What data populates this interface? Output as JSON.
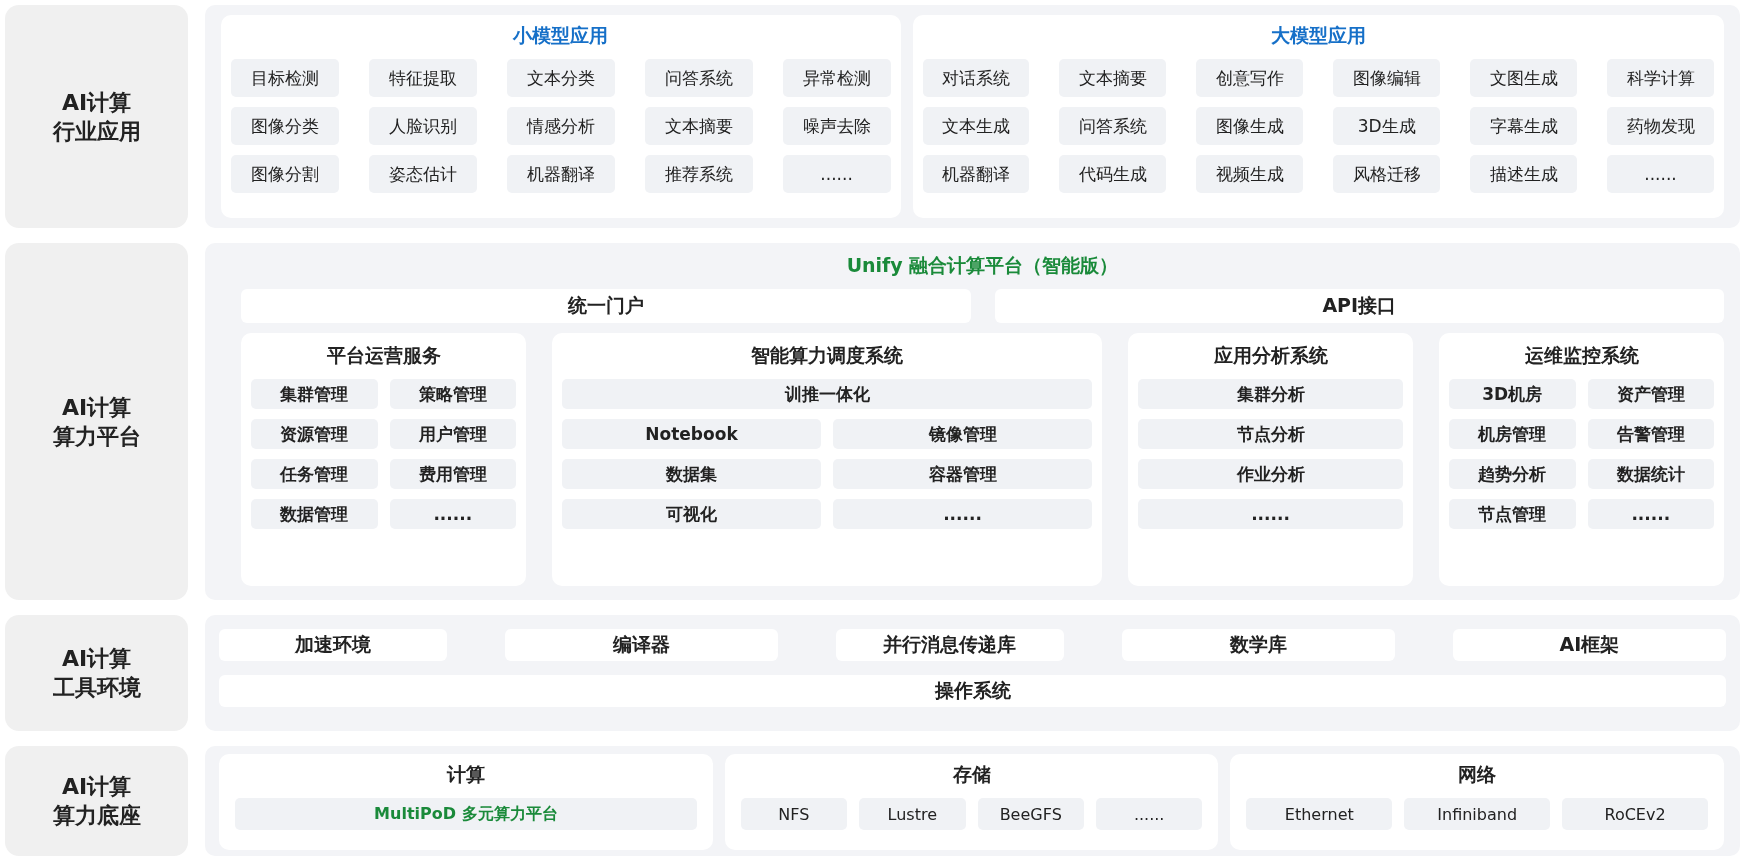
{
  "rows": [
    {
      "kind": "apps",
      "label": [
        "AI计算",
        "行业应用"
      ],
      "groups": [
        {
          "title": "小模型应用",
          "items": [
            "目标检测",
            "特征提取",
            "文本分类",
            "问答系统",
            "异常检测",
            "图像分类",
            "人脸识别",
            "情感分析",
            "文本摘要",
            "噪声去除",
            "图像分割",
            "姿态估计",
            "机器翻译",
            "推荐系统",
            "......"
          ]
        },
        {
          "title": "大模型应用",
          "items": [
            "对话系统",
            "文本摘要",
            "创意写作",
            "图像编辑",
            "文图生成",
            "科学计算",
            "文本生成",
            "问答系统",
            "图像生成",
            "3D生成",
            "字幕生成",
            "药物发现",
            "机器翻译",
            "代码生成",
            "视频生成",
            "风格迁移",
            "描述生成",
            "......"
          ]
        }
      ]
    },
    {
      "kind": "platform",
      "label": [
        "AI计算",
        "算力平台"
      ],
      "title": "Unify 融合计算平台（智能版）",
      "portals": [
        "统一门户",
        "API接口"
      ],
      "systems": [
        {
          "title": "平台运营服务",
          "items": [
            "集群管理",
            "策略管理",
            "资源管理",
            "用户管理",
            "任务管理",
            "费用管理",
            "数据管理",
            "......"
          ]
        },
        {
          "title": "智能算力调度系统",
          "banner": "训推一体化",
          "items": [
            "Notebook",
            "镜像管理",
            "数据集",
            "容器管理",
            "可视化",
            "......"
          ]
        },
        {
          "title": "应用分析系统",
          "items": [
            "集群分析",
            "节点分析",
            "作业分析",
            "......"
          ]
        },
        {
          "title": "运维监控系统",
          "items": [
            "3D机房",
            "资产管理",
            "机房管理",
            "告警管理",
            "趋势分析",
            "数据统计",
            "节点管理",
            "......"
          ]
        }
      ]
    },
    {
      "kind": "tools",
      "label": [
        "AI计算",
        "工具环境"
      ],
      "items": [
        "加速环境",
        "编译器",
        "并行消息传递库",
        "数学库",
        "AI框架"
      ],
      "base": "操作系统"
    },
    {
      "kind": "base",
      "label": [
        "AI计算",
        "算力底座"
      ],
      "sections": [
        {
          "title": "计算",
          "items": [
            {
              "text": "MultiPoD 多元算力平台",
              "highlight": true
            }
          ]
        },
        {
          "title": "存储",
          "items": [
            {
              "text": "NFS",
              "highlight": false
            },
            {
              "text": "Lustre",
              "highlight": false
            },
            {
              "text": "BeeGFS",
              "highlight": false
            },
            {
              "text": "......",
              "highlight": false
            }
          ]
        },
        {
          "title": "网络",
          "items": [
            {
              "text": "Ethernet",
              "highlight": false
            },
            {
              "text": "Infiniband",
              "highlight": false
            },
            {
              "text": "RoCEv2",
              "highlight": false
            }
          ]
        }
      ]
    }
  ]
}
